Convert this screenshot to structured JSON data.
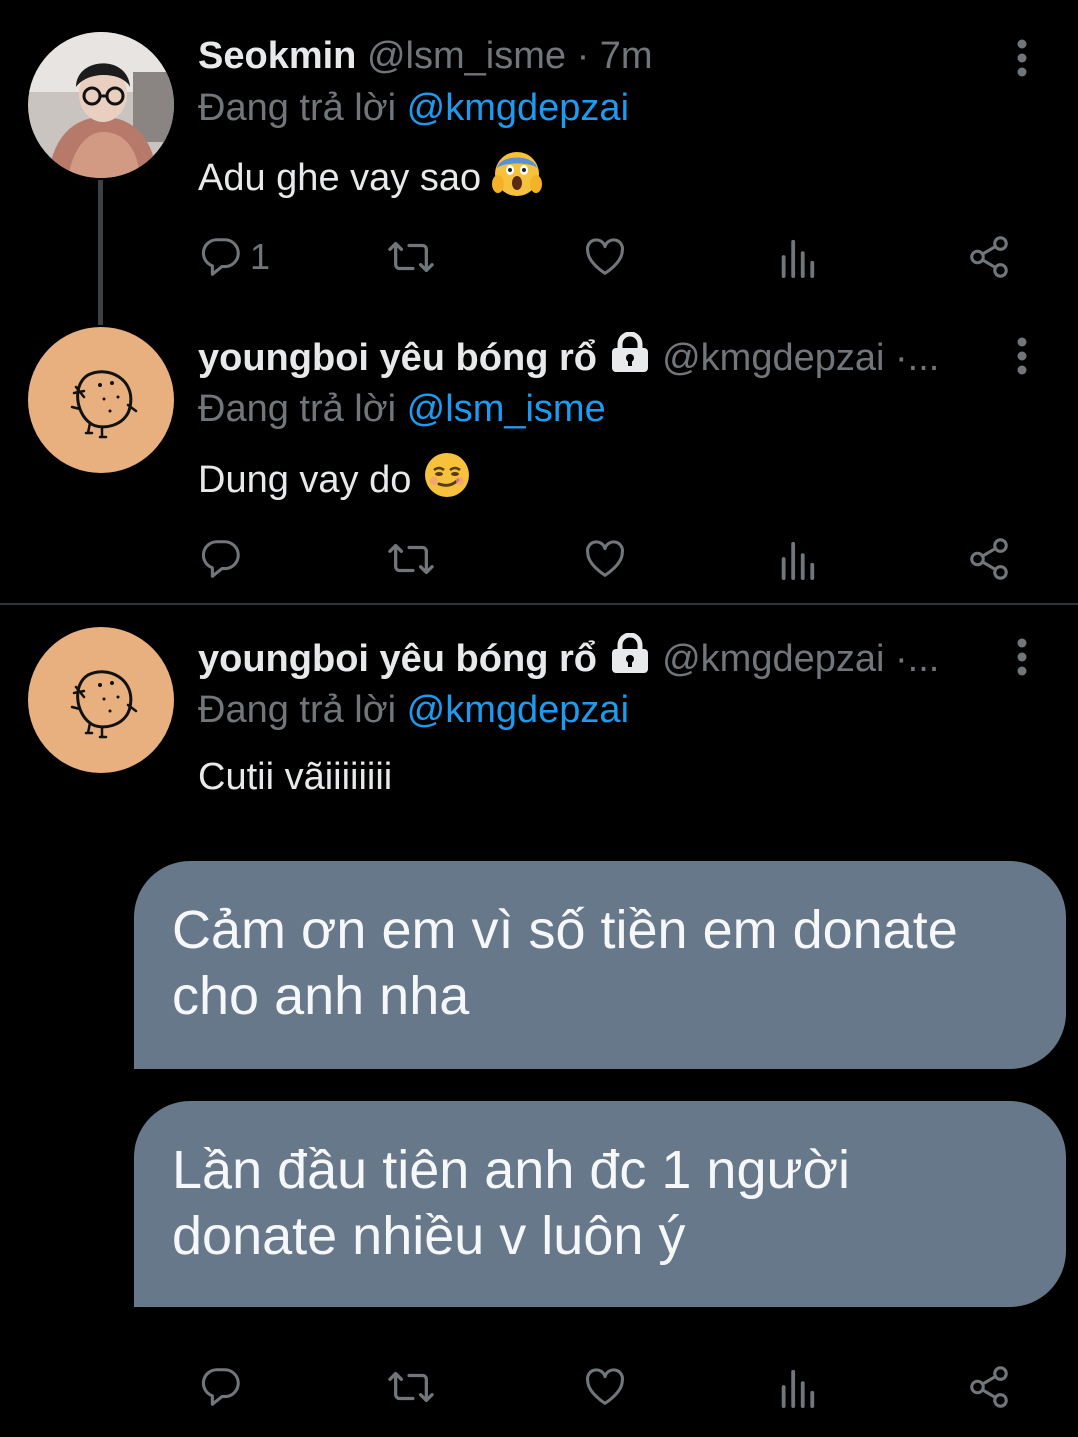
{
  "colors": {
    "background": "#000000",
    "text": "#e7e9ea",
    "muted": "#71767b",
    "mention": "#1d9bf0",
    "divider": "#2f3336",
    "bubble": "#66788a",
    "avatar_bg": "#e8b07e"
  },
  "tweets": [
    {
      "name": "Seokmin",
      "handle": "@lsm_isme",
      "time": "· 7m",
      "reply_prefix": "Đang trả lời",
      "reply_to": "@kmgdepzai",
      "text": "Adu ghe vay sao",
      "emoji": "face-screaming-in-fear",
      "reply_count": "1"
    },
    {
      "name": "youngboi yêu bóng rổ",
      "handle": "@kmgdepzai",
      "time": "·...",
      "reply_prefix": "Đang trả lời",
      "reply_to": "@lsm_isme",
      "text": "Dung vay do",
      "emoji": "smirking-face",
      "reply_count": ""
    },
    {
      "name": "youngboi yêu bóng rổ",
      "handle": "@kmgdepzai",
      "time": "·...",
      "reply_prefix": "Đang trả lời",
      "reply_to": "@kmgdepzai",
      "text": "Cutii vãiiiiiiii",
      "reply_count": ""
    }
  ],
  "messages": [
    {
      "line1": "Cảm ơn em vì số tiền em donate",
      "line2": "cho anh nha"
    },
    {
      "line1": "Lần đầu tiên anh đc 1 người",
      "line2": "donate nhiều v luôn ý"
    }
  ],
  "icons": {
    "reply": "reply-icon",
    "retweet": "retweet-icon",
    "like": "heart-icon",
    "views": "analytics-icon",
    "share": "share-icon",
    "more": "more-vertical-icon",
    "lock": "lock-icon"
  }
}
